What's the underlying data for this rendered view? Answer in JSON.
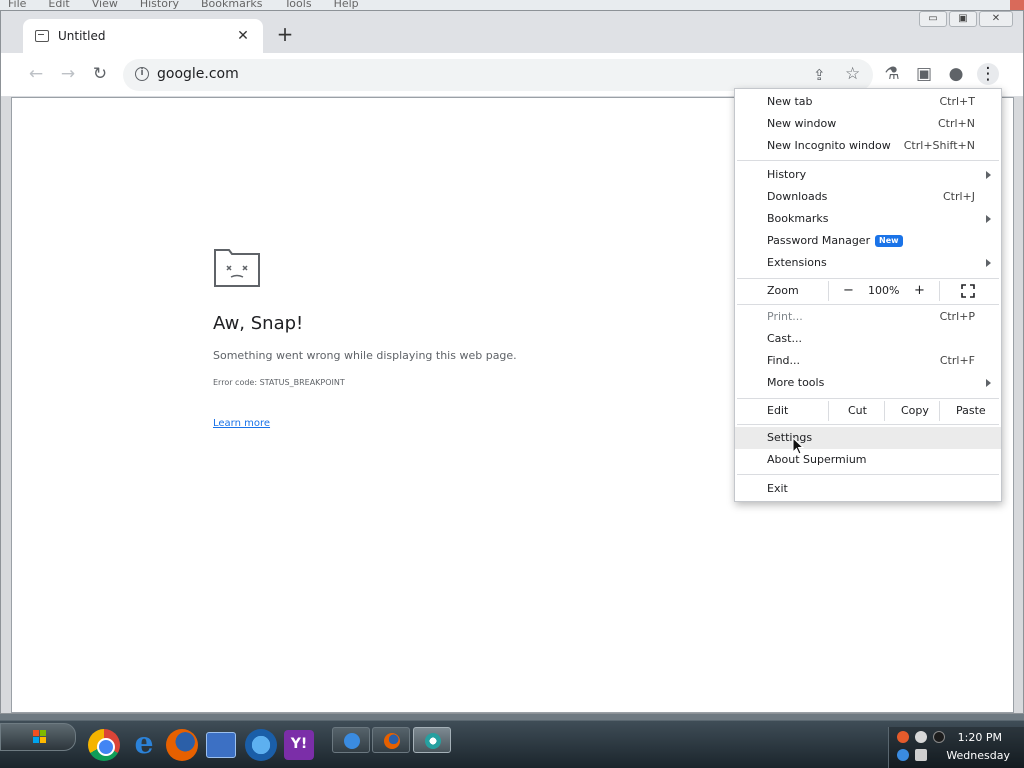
{
  "background_menubar": [
    "File",
    "Edit",
    "View",
    "History",
    "Bookmarks",
    "Tools",
    "Help"
  ],
  "window_controls": {
    "minimize": "▭",
    "maximize": "▣",
    "close": "✕"
  },
  "tab": {
    "title": "Untitled",
    "close": "✕",
    "new_tab": "+"
  },
  "toolbar": {
    "back": "←",
    "forward": "→",
    "reload": "↻",
    "url": "google.com",
    "share": "⇪",
    "bookmark": "☆",
    "labs": "⚗",
    "side_panel": "▣",
    "profile": "●",
    "menu": "⋮"
  },
  "page": {
    "title": "Aw, Snap!",
    "message": "Something went wrong while displaying this web page.",
    "error_code": "Error code: STATUS_BREAKPOINT",
    "learn_more": "Learn more"
  },
  "menu": {
    "new_tab": {
      "label": "New tab",
      "shortcut": "Ctrl+T"
    },
    "new_window": {
      "label": "New window",
      "shortcut": "Ctrl+N"
    },
    "new_incognito": {
      "label": "New Incognito window",
      "shortcut": "Ctrl+Shift+N"
    },
    "history": {
      "label": "History"
    },
    "downloads": {
      "label": "Downloads",
      "shortcut": "Ctrl+J"
    },
    "bookmarks": {
      "label": "Bookmarks"
    },
    "password_manager": {
      "label": "Password Manager",
      "badge": "New"
    },
    "extensions": {
      "label": "Extensions"
    },
    "zoom": {
      "label": "Zoom",
      "minus": "−",
      "value": "100%",
      "plus": "+"
    },
    "print": {
      "label": "Print...",
      "shortcut": "Ctrl+P"
    },
    "cast": {
      "label": "Cast..."
    },
    "find": {
      "label": "Find...",
      "shortcut": "Ctrl+F"
    },
    "more_tools": {
      "label": "More tools"
    },
    "edit": {
      "label": "Edit",
      "cut": "Cut",
      "copy": "Copy",
      "paste": "Paste"
    },
    "settings": {
      "label": "Settings"
    },
    "about": {
      "label": "About Supermium"
    },
    "exit": {
      "label": "Exit"
    }
  },
  "taskbar": {
    "clock_time": "1:20 PM",
    "clock_day": "Wednesday"
  },
  "colors": {
    "accent": "#1a73e8",
    "menu_hover": "#ebebeb"
  }
}
